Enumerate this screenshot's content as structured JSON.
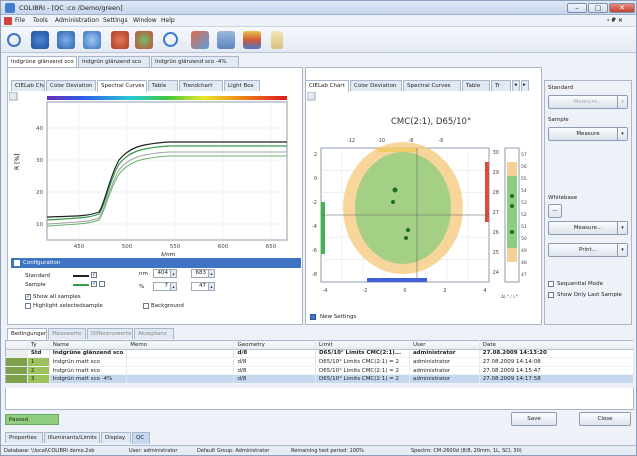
{
  "window": {
    "title": "COLIBRI - [QC :co /Demo/green]",
    "min": "–",
    "max": "□",
    "close": "✕"
  },
  "menu": {
    "items": [
      "File",
      "Tools",
      "Administration",
      "Settings",
      "Window",
      "Help"
    ],
    "right": "- ₽ ×"
  },
  "toolbar": {
    "icons": [
      "search-icon",
      "tool-1-icon",
      "tool-2-icon",
      "tool-3-icon",
      "tool-4-icon",
      "tool-5-icon",
      "zoom-icon",
      "tool-7-icon",
      "tool-8-icon",
      "tool-9-icon",
      "tool-10-icon"
    ]
  },
  "doc_tabs": [
    "Indgrüne glänzend sco",
    "Indgrün glänzend sco",
    "Indgrün glänzend sco -4%"
  ],
  "left_tabs": [
    "CIELab Chart",
    "Color Deviation",
    "Spectral Curves",
    "Table",
    "Trendchart",
    "Light Box"
  ],
  "right_tabs": [
    "CIELab Chart",
    "Color Deviation",
    "Spectral Curves",
    "Table",
    "Tr"
  ],
  "spectral_chart": {
    "ylabel": "R [%]",
    "xlabel": "λ/nm",
    "yticks": [
      "40",
      "30",
      "20",
      "10"
    ],
    "xticks": [
      "450",
      "500",
      "550",
      "600",
      "650"
    ]
  },
  "config": {
    "title": "Configuration",
    "standard_label": "Standard",
    "sample_label": "Sample",
    "nm_label": "nm",
    "pct_label": "%",
    "nm_from": "404",
    "nm_to": "683",
    "pct_from": "7",
    "pct_to": "47",
    "show_all": "Show all samples",
    "highlight": "Highlight selectedsample",
    "background": "Background"
  },
  "cielab_chart": {
    "title": "CMC(2:1), D65/10°",
    "top_labels": [
      "-12",
      "-10",
      "-8",
      "-6"
    ],
    "bottom_labels": [
      "-4",
      "-2",
      "0",
      "2",
      "4"
    ],
    "left_labels": [
      "2",
      "0",
      "-2",
      "-4",
      "-6",
      "-8"
    ],
    "right_labels": [
      "30",
      "29",
      "28",
      "27",
      "26",
      "25",
      "24"
    ],
    "bar_labels": [
      "57",
      "56",
      "55",
      "54",
      "53",
      "52",
      "51",
      "50",
      "49",
      "48",
      "47"
    ],
    "bar_foot": "ΔL* / L*",
    "new_settings": "New Settings"
  },
  "side_panel": {
    "standard_label": "Standard",
    "measure_disabled": "Measure...",
    "sample_label": "Sample",
    "measure": "Measure",
    "whitebase_label": "Whitebase",
    "measure2": "Measure...",
    "print": "Print...",
    "sequential": "Sequential Mode",
    "show_only_last": "Show Only Last Sample"
  },
  "bottom_tabs": [
    "Bedingungen",
    "Messwerte",
    "Differenzwerte",
    "Akzeptanz"
  ],
  "table": {
    "columns": [
      "Ty",
      "Name",
      "Memo",
      "Geometry",
      "Limit",
      "User",
      "Date"
    ],
    "rows": [
      {
        "n": "Std",
        "name": "Indgrüne glänzend sco",
        "memo": "",
        "geometry": "d/8",
        "limit": "D65/10° Limits CMC(2:1)...",
        "user": "administrator",
        "date": "27.08.2009 14:13:20"
      },
      {
        "n": "1",
        "name": "Indgrün matt sco",
        "memo": "",
        "geometry": "d/8",
        "limit": "D65/10° Limits CMC(2:1) = 2",
        "user": "administrator",
        "date": "27.08.2009 14:14:08"
      },
      {
        "n": "2",
        "name": "Indgrün matt sco",
        "memo": "",
        "geometry": "d/8",
        "limit": "D65/10° Limits CMC(2:1) = 2",
        "user": "administrator",
        "date": "27.08.2009 14:15:47"
      },
      {
        "n": "3",
        "name": "Indgrün matt sco -4%",
        "memo": "",
        "geometry": "d/8",
        "limit": "D65/10° Limits CMC(2:1) = 2",
        "user": "administrator",
        "date": "27.08.2009 14:17:58"
      }
    ]
  },
  "result": {
    "text": "Passed"
  },
  "actions": {
    "save": "Save",
    "close": "Close"
  },
  "panel_tabs": [
    "Properties",
    "Illuminants/Limits",
    "Display",
    "QC"
  ],
  "status": {
    "database": "Database: \\\\local\\COLIBRI demo.2xb",
    "user": "User: administrator",
    "group": "Default Group: Administrator",
    "remaining": "Remaining test period: 100%",
    "spectro": "Spectro: CM-2600d (8/8, 20mm, 1L, SCI, 30)"
  },
  "colors": {
    "standard": "#222222",
    "sample": "#3a9a4a",
    "accept": "#8fce7f",
    "tolerance": "#f5c77a",
    "header": "#3f73c4"
  }
}
